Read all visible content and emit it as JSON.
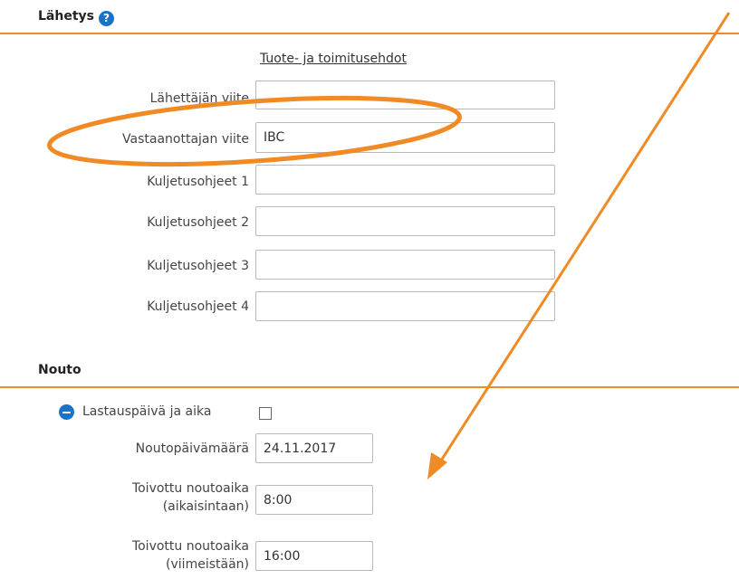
{
  "shipment": {
    "title": "Lähetys",
    "help_icon": "?",
    "terms_link": "Tuote- ja toimitusehdot",
    "fields": [
      {
        "label": "Lähettäjän viite",
        "value": ""
      },
      {
        "label": "Vastaanottajan viite",
        "value": "IBC"
      },
      {
        "label": "Kuljetusohjeet 1",
        "value": ""
      },
      {
        "label": "Kuljetusohjeet 2",
        "value": ""
      },
      {
        "label": "Kuljetusohjeet 3",
        "value": ""
      },
      {
        "label": "Kuljetusohjeet 4",
        "value": ""
      }
    ]
  },
  "pickup": {
    "title": "Nouto",
    "loading_toggle_label": "Lastauspäivä ja aika",
    "loading_checked": false,
    "date_label": "Noutopäivämäärä",
    "date_value": "24.11.2017",
    "earliest_label_line1": "Toivottu noutoaika",
    "earliest_label_line2": "(aikaisintaan)",
    "earliest_value": "8:00",
    "latest_label_line1": "Toivottu noutoaika",
    "latest_label_line2": "(viimeistään)",
    "latest_value": "16:00"
  },
  "annotation": {
    "color": "#f08a24"
  }
}
